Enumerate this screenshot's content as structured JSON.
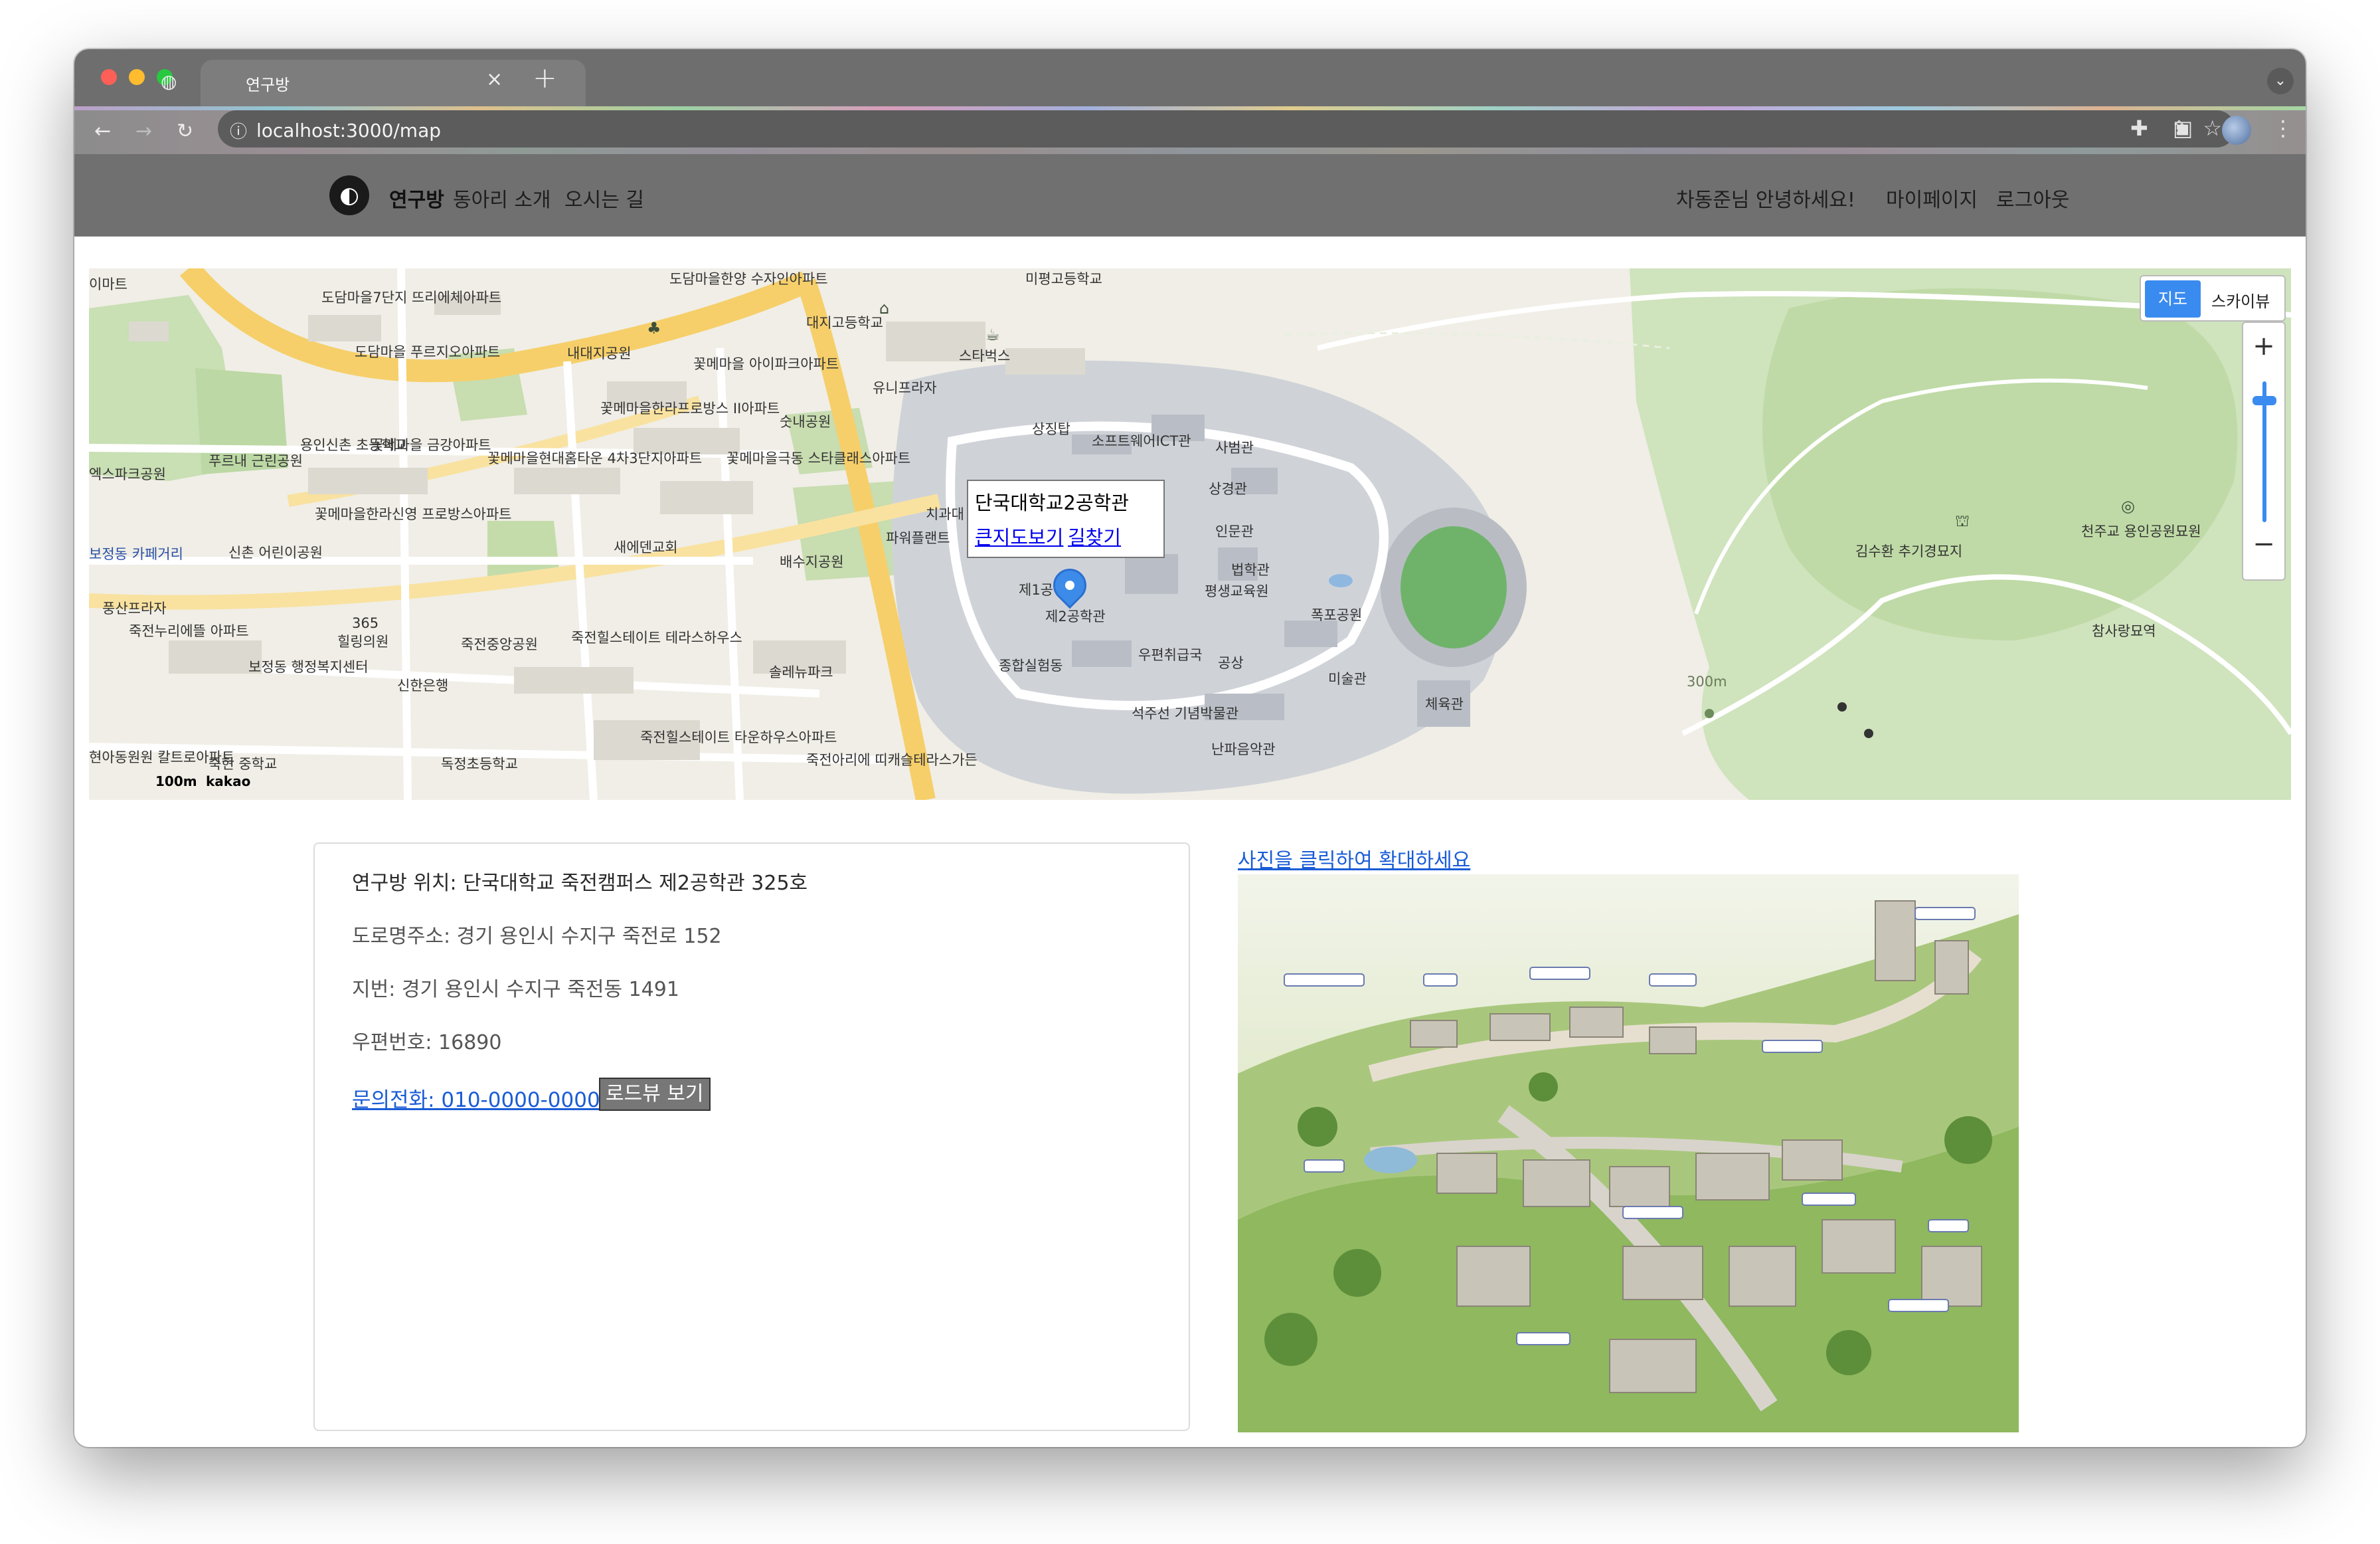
{
  "browser": {
    "tab_title": "연구방",
    "url": "localhost:3000/map",
    "new_tab_label": "+",
    "close_label": "×"
  },
  "header": {
    "brand": "연구방",
    "nav": [
      "동아리 소개",
      "오시는 길"
    ],
    "greeting": "차동준님 안녕하세요!",
    "mypage": "마이페이지",
    "logout": "로그아웃"
  },
  "map": {
    "type_map": "지도",
    "type_skyview": "스카이뷰",
    "zoom_in": "+",
    "zoom_out": "−",
    "info_title": "단국대학교2공학관",
    "info_bigmap": "큰지도보기",
    "info_directions": "길찾기",
    "scale": "100m",
    "provider": "kakao",
    "labels": [
      "이마트",
      "도담마을7단지 뜨리에체아파트",
      "도담마을 푸르지오아파트",
      "내대지공원",
      "꽃메마을 아이파크아파트",
      "꽃메마을한라프로방스 II아파트",
      "숫내공원",
      "꽃메마을현대홈타운 4차3단지아파트",
      "꽃메마을극동 스타클래스아파트",
      "용인신촌 초등학교",
      "꽃메마을 금강아파트",
      "엑스파크공원",
      "푸르내 근린공원",
      "꽃메마을한라신영 프로방스아파트",
      "새에덴교회",
      "배수지공원",
      "보정동 카페거리",
      "신촌 어린이공원",
      "풍산프라자",
      "죽전누리에뜰 아파트",
      "힐링의원",
      "보정동 행정복지센터",
      "신한은행",
      "죽전중앙공원",
      "죽전힐스테이트 테라스하우스",
      "솔레뉴파크",
      "죽전힐스테이트 타운하우스아파트",
      "죽전아리에 띠캐슬테라스가든",
      "현아동원원 칼트로아파트",
      "죽현 중학교",
      "독정초등학교",
      "대지고등학교",
      "스타벅스",
      "유니프라자",
      "상징탑",
      "소프트웨어ICT관",
      "사범관",
      "상경관",
      "인문관",
      "치과대",
      "파워플랜트",
      "법학관",
      "평생교육원",
      "제1공",
      "제2공학관",
      "종합실험동",
      "우편취급국",
      "공상",
      "폭포공원",
      "미술관",
      "체육관",
      "석주선 기념박물관",
      "난파음악관",
      "김수환 추기경묘지",
      "천주교 용인공원묘원",
      "참사랑묘역",
      "300m",
      "도담마을한양 수자인아파트",
      "미평고등학교",
      "365"
    ]
  },
  "info": {
    "location": "연구방 위치: 단국대학교 죽전캠퍼스 제2공학관 325호",
    "road_address": "도로명주소: 경기 용인시 수지구 죽전로 152",
    "lot_address": "지번: 경기 용인시 수지구 죽전동 1491",
    "postal": "우편번호: 16890",
    "phone": "문의전화: 010-0000-0000",
    "roadview": "로드뷰 보기"
  },
  "photo": {
    "caption": "사진을 클릭하여 확대하세요"
  }
}
